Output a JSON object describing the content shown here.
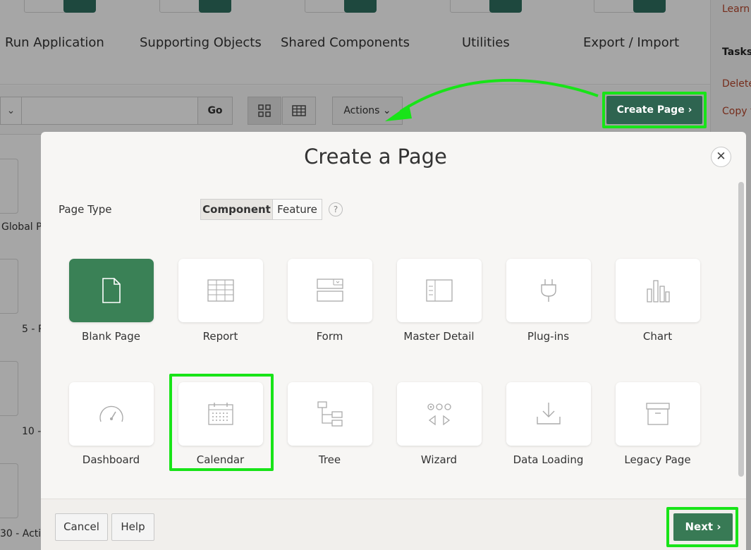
{
  "background": {
    "top_nav": [
      {
        "label": "Run Application"
      },
      {
        "label": "Supporting Objects"
      },
      {
        "label": "Shared Components"
      },
      {
        "label": "Utilities"
      },
      {
        "label": "Export / Import"
      }
    ],
    "toolbar": {
      "go_label": "Go",
      "actions_label": "Actions",
      "create_page_label": "Create Page"
    },
    "right_panel": {
      "learn": "Learn",
      "tasks": "Tasks",
      "delete": "Delete",
      "copy": "Copy t"
    },
    "page_list": [
      {
        "label": "Global P"
      },
      {
        "label": "5 - P"
      },
      {
        "label": "10 -"
      },
      {
        "label": "30 - Acti"
      }
    ]
  },
  "dialog": {
    "title": "Create a Page",
    "close_icon": "close-icon",
    "page_type_label": "Page Type",
    "segments": [
      {
        "label": "Component",
        "active": true
      },
      {
        "label": "Feature",
        "active": false
      }
    ],
    "help_glyph": "?",
    "page_types": [
      {
        "label": "Blank Page",
        "icon": "blank-page-icon",
        "selected": true
      },
      {
        "label": "Report",
        "icon": "report-icon",
        "selected": false
      },
      {
        "label": "Form",
        "icon": "form-icon",
        "selected": false
      },
      {
        "label": "Master Detail",
        "icon": "master-detail-icon",
        "selected": false
      },
      {
        "label": "Plug-ins",
        "icon": "plug-in-icon",
        "selected": false
      },
      {
        "label": "Chart",
        "icon": "chart-icon",
        "selected": false
      },
      {
        "label": "Dashboard",
        "icon": "dashboard-icon",
        "selected": false
      },
      {
        "label": "Calendar",
        "icon": "calendar-icon",
        "selected": false
      },
      {
        "label": "Tree",
        "icon": "tree-icon",
        "selected": false
      },
      {
        "label": "Wizard",
        "icon": "wizard-icon",
        "selected": false
      },
      {
        "label": "Data Loading",
        "icon": "data-loading-icon",
        "selected": false
      },
      {
        "label": "Legacy Page",
        "icon": "legacy-page-icon",
        "selected": false
      }
    ],
    "footer": {
      "cancel_label": "Cancel",
      "help_label": "Help",
      "next_label": "Next"
    }
  },
  "colors": {
    "highlight": "#18e418",
    "primary": "#387a55",
    "create_page": "#2e6450"
  }
}
